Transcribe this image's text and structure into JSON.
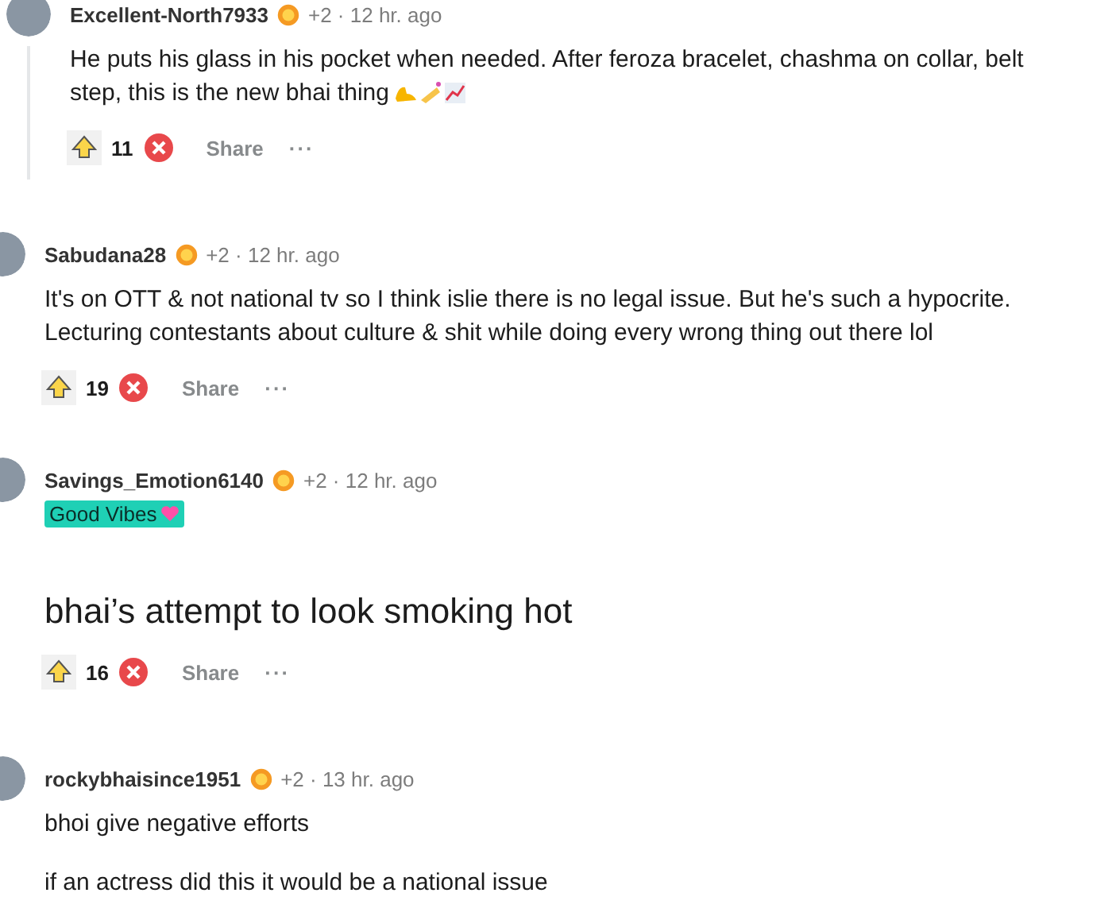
{
  "comments": [
    {
      "kind": "reply",
      "username": "Excellent-North7933",
      "meta": "+2 · 12 hr. ago",
      "paragraphs": [
        "He puts his glass in his pocket when needed. After feroza bracelet, chashma on collar, belt step, this is the new bhai thing"
      ],
      "emoji_after_text": true,
      "votes": "11",
      "share": "Share",
      "more": "···"
    },
    {
      "kind": "comment",
      "username": "Sabudana28",
      "meta": "+2 · 12 hr. ago",
      "paragraphs": [
        "It's on OTT & not national tv so I think islie there is no legal issue. But he's such a hypocrite. Lecturing contestants about culture & shit while doing every wrong thing out there lol"
      ],
      "emoji_after_text": false,
      "votes": "19",
      "share": "Share",
      "more": "···"
    },
    {
      "kind": "large",
      "username": "Savings_Emotion6140",
      "meta": "+2 · 12 hr. ago",
      "flair": "Good Vibes",
      "paragraphs": [
        "bhai’s attempt to look smoking hot"
      ],
      "emoji_after_text": false,
      "votes": "16",
      "share": "Share",
      "more": "···"
    },
    {
      "kind": "comment",
      "username": "rockybhaisince1951",
      "meta": "+2 · 13 hr. ago",
      "paragraphs": [
        "bhoi give negative efforts",
        "if an actress did this it would be a national issue"
      ],
      "emoji_after_text": false
    }
  ]
}
